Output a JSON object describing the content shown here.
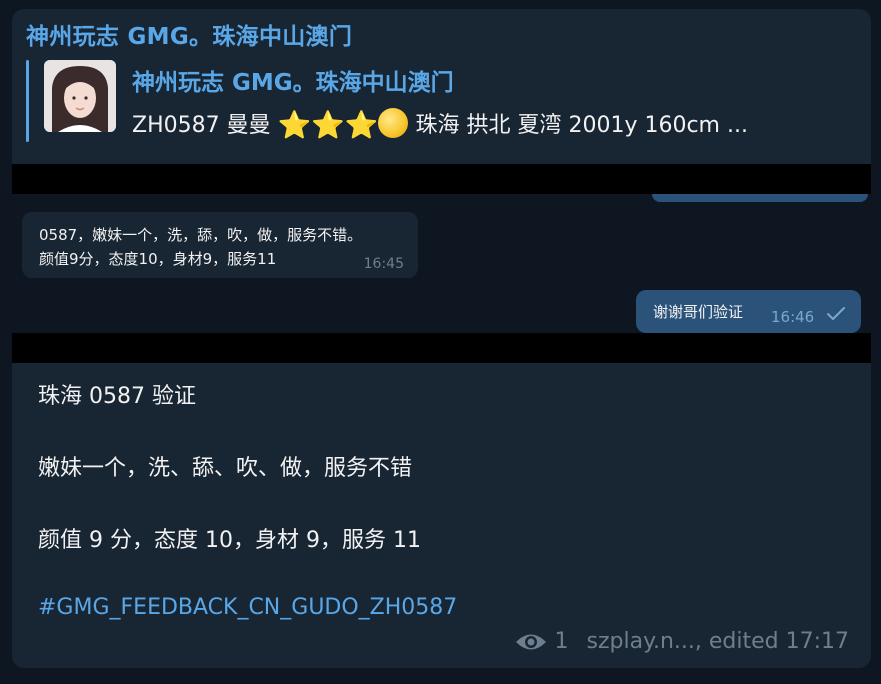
{
  "channel": {
    "name": "神州玩志 GMG。珠海中山澳门"
  },
  "reply": {
    "title": "神州玩志 GMG。珠海中山澳门",
    "code": "ZH0587 曼曼",
    "stars": [
      "⭐",
      "⭐",
      "⭐"
    ],
    "moon_icon": "moon-icon",
    "details": "珠海 拱北 夏湾 2001y  160cm ..."
  },
  "incoming_message": {
    "line1": "0587，嫩妹一个，洗，舔，吹，做，服务不错。",
    "line2": "颜值9分，态度10，身材9，服务11",
    "time": "16:45"
  },
  "outgoing_message": {
    "text": "谢谢哥们验证",
    "time": "16:46",
    "status_icon": "check-icon"
  },
  "post": {
    "line1": "珠海 0587 验证",
    "line2": "嫩妹一个，洗、舔、吹、做，服务不错",
    "line3": "颜值 9 分，态度 10，身材 9，服务 11",
    "hashtag": "#GMG_FEEDBACK_CN_GUDO_ZH0587",
    "views": "1",
    "footer": "szplay.n..., edited 17:17"
  },
  "colors": {
    "background": "#0e1621",
    "bubble_in": "#182533",
    "bubble_out": "#2b5278",
    "accent": "#5aa7e8"
  }
}
